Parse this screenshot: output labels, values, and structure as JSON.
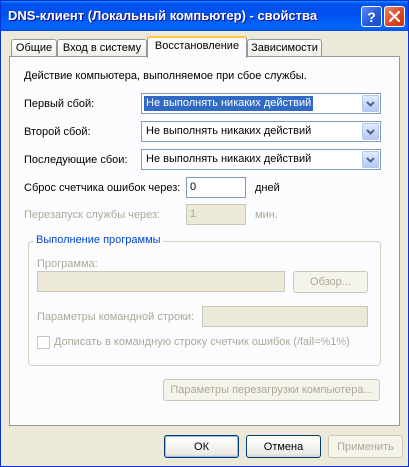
{
  "window": {
    "title": "DNS-клиент (Локальный компьютер) - свойства"
  },
  "tabs": [
    {
      "label": "Общие"
    },
    {
      "label": "Вход в систему"
    },
    {
      "label": "Восстановление"
    },
    {
      "label": "Зависимости"
    }
  ],
  "recovery": {
    "description": "Действие компьютера, выполняемое при сбое службы.",
    "first_failure": {
      "label": "Первый сбой:",
      "value": "Не выполнять никаких действий"
    },
    "second_failure": {
      "label": "Второй сбой:",
      "value": "Не выполнять никаких действий"
    },
    "subsequent_failures": {
      "label": "Последующие сбои:",
      "value": "Не выполнять никаких действий"
    },
    "reset_count": {
      "label": "Сброс счетчика ошибок через:",
      "value": "0",
      "unit": "дней"
    },
    "restart_service": {
      "label": "Перезапуск службы через:",
      "value": "1",
      "unit": "мин."
    },
    "program_group": {
      "title": "Выполнение программы",
      "program_label": "Программа:",
      "program_value": "",
      "browse_label": "Обзор...",
      "params_label": "Параметры командной строки:",
      "params_value": "",
      "append_label": "Дописать в командную строку счетчик ошибок (/fail=%1%)"
    },
    "restart_computer_label": "Параметры перезагрузки компьютера..."
  },
  "buttons": {
    "ok": "ОК",
    "cancel": "Отмена",
    "apply": "Применить"
  },
  "colors": {
    "title_bar": "#0054e3",
    "selection": "#316ac5",
    "group_title": "#0046d5",
    "disabled_text": "#aca899"
  }
}
